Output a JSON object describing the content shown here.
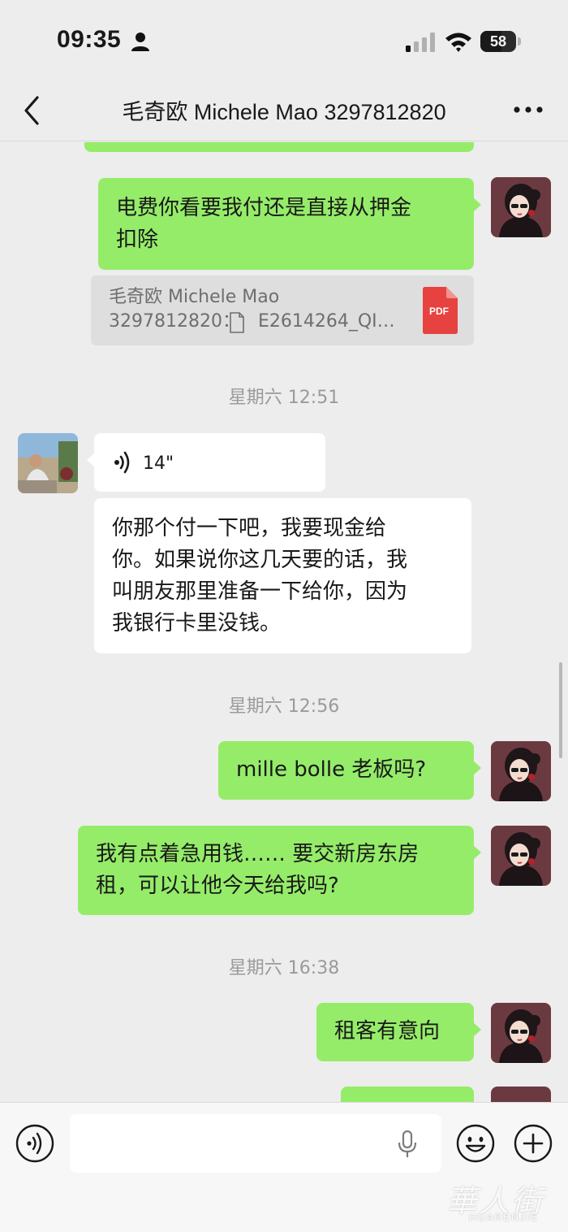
{
  "status_bar": {
    "time": "09:35",
    "battery": "58",
    "battery_level": 0.58
  },
  "nav": {
    "title": "毛奇欧 Michele Mao 3297812820",
    "back_icon": "chevron-left-icon",
    "more_icon": "more-dots-icon"
  },
  "messages": {
    "m1": {
      "text": "电费你看要我付还是直接从押金\n扣除"
    },
    "quote": {
      "line1": "毛奇欧 Michele Mao",
      "line2": "3297812820： E2614264_QI…",
      "file_type": "PDF"
    },
    "ts1": "星期六 12:51",
    "voice": {
      "length": "14\""
    },
    "m2": {
      "text": "你那个付一下吧，我要现金给\n你。如果说你这几天要的话，我\n叫朋友那里准备一下给你，因为\n我银行卡里没钱。"
    },
    "ts2": "星期六 12:56",
    "m3": {
      "text": "mille bolle 老板吗?"
    },
    "m4": {
      "text": "我有点着急用钱…… 要交新房东房\n租，可以让他今天给我吗?"
    },
    "ts3": "星期六 16:38",
    "m5": {
      "text": "租客有意向"
    }
  },
  "input_bar": {
    "voice_icon": "voice-toggle-icon",
    "emoji_icon": "emoji-icon",
    "plus_icon": "plus-icon",
    "mic_icon": "mic-icon"
  },
  "watermark": {
    "main": "華人街",
    "sub": "HUARENJIE"
  },
  "colors": {
    "background": "#ededed",
    "outgoing_bubble": "#95ec69",
    "incoming_bubble": "#ffffff",
    "timestamp_text": "#9a9a9a",
    "pdf_red": "#e64340"
  }
}
